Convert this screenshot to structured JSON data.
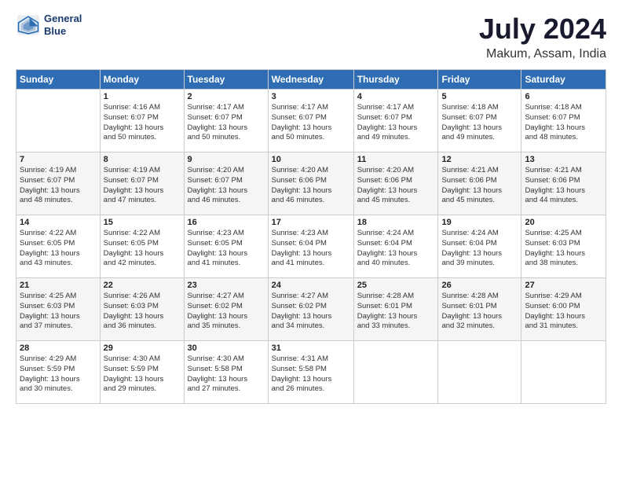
{
  "header": {
    "logo_line1": "General",
    "logo_line2": "Blue",
    "month_year": "July 2024",
    "location": "Makum, Assam, India"
  },
  "weekdays": [
    "Sunday",
    "Monday",
    "Tuesday",
    "Wednesday",
    "Thursday",
    "Friday",
    "Saturday"
  ],
  "weeks": [
    [
      {
        "day": "",
        "info": ""
      },
      {
        "day": "1",
        "info": "Sunrise: 4:16 AM\nSunset: 6:07 PM\nDaylight: 13 hours\nand 50 minutes."
      },
      {
        "day": "2",
        "info": "Sunrise: 4:17 AM\nSunset: 6:07 PM\nDaylight: 13 hours\nand 50 minutes."
      },
      {
        "day": "3",
        "info": "Sunrise: 4:17 AM\nSunset: 6:07 PM\nDaylight: 13 hours\nand 50 minutes."
      },
      {
        "day": "4",
        "info": "Sunrise: 4:17 AM\nSunset: 6:07 PM\nDaylight: 13 hours\nand 49 minutes."
      },
      {
        "day": "5",
        "info": "Sunrise: 4:18 AM\nSunset: 6:07 PM\nDaylight: 13 hours\nand 49 minutes."
      },
      {
        "day": "6",
        "info": "Sunrise: 4:18 AM\nSunset: 6:07 PM\nDaylight: 13 hours\nand 48 minutes."
      }
    ],
    [
      {
        "day": "7",
        "info": "Sunrise: 4:19 AM\nSunset: 6:07 PM\nDaylight: 13 hours\nand 48 minutes."
      },
      {
        "day": "8",
        "info": "Sunrise: 4:19 AM\nSunset: 6:07 PM\nDaylight: 13 hours\nand 47 minutes."
      },
      {
        "day": "9",
        "info": "Sunrise: 4:20 AM\nSunset: 6:07 PM\nDaylight: 13 hours\nand 46 minutes."
      },
      {
        "day": "10",
        "info": "Sunrise: 4:20 AM\nSunset: 6:06 PM\nDaylight: 13 hours\nand 46 minutes."
      },
      {
        "day": "11",
        "info": "Sunrise: 4:20 AM\nSunset: 6:06 PM\nDaylight: 13 hours\nand 45 minutes."
      },
      {
        "day": "12",
        "info": "Sunrise: 4:21 AM\nSunset: 6:06 PM\nDaylight: 13 hours\nand 45 minutes."
      },
      {
        "day": "13",
        "info": "Sunrise: 4:21 AM\nSunset: 6:06 PM\nDaylight: 13 hours\nand 44 minutes."
      }
    ],
    [
      {
        "day": "14",
        "info": "Sunrise: 4:22 AM\nSunset: 6:05 PM\nDaylight: 13 hours\nand 43 minutes."
      },
      {
        "day": "15",
        "info": "Sunrise: 4:22 AM\nSunset: 6:05 PM\nDaylight: 13 hours\nand 42 minutes."
      },
      {
        "day": "16",
        "info": "Sunrise: 4:23 AM\nSunset: 6:05 PM\nDaylight: 13 hours\nand 41 minutes."
      },
      {
        "day": "17",
        "info": "Sunrise: 4:23 AM\nSunset: 6:04 PM\nDaylight: 13 hours\nand 41 minutes."
      },
      {
        "day": "18",
        "info": "Sunrise: 4:24 AM\nSunset: 6:04 PM\nDaylight: 13 hours\nand 40 minutes."
      },
      {
        "day": "19",
        "info": "Sunrise: 4:24 AM\nSunset: 6:04 PM\nDaylight: 13 hours\nand 39 minutes."
      },
      {
        "day": "20",
        "info": "Sunrise: 4:25 AM\nSunset: 6:03 PM\nDaylight: 13 hours\nand 38 minutes."
      }
    ],
    [
      {
        "day": "21",
        "info": "Sunrise: 4:25 AM\nSunset: 6:03 PM\nDaylight: 13 hours\nand 37 minutes."
      },
      {
        "day": "22",
        "info": "Sunrise: 4:26 AM\nSunset: 6:03 PM\nDaylight: 13 hours\nand 36 minutes."
      },
      {
        "day": "23",
        "info": "Sunrise: 4:27 AM\nSunset: 6:02 PM\nDaylight: 13 hours\nand 35 minutes."
      },
      {
        "day": "24",
        "info": "Sunrise: 4:27 AM\nSunset: 6:02 PM\nDaylight: 13 hours\nand 34 minutes."
      },
      {
        "day": "25",
        "info": "Sunrise: 4:28 AM\nSunset: 6:01 PM\nDaylight: 13 hours\nand 33 minutes."
      },
      {
        "day": "26",
        "info": "Sunrise: 4:28 AM\nSunset: 6:01 PM\nDaylight: 13 hours\nand 32 minutes."
      },
      {
        "day": "27",
        "info": "Sunrise: 4:29 AM\nSunset: 6:00 PM\nDaylight: 13 hours\nand 31 minutes."
      }
    ],
    [
      {
        "day": "28",
        "info": "Sunrise: 4:29 AM\nSunset: 5:59 PM\nDaylight: 13 hours\nand 30 minutes."
      },
      {
        "day": "29",
        "info": "Sunrise: 4:30 AM\nSunset: 5:59 PM\nDaylight: 13 hours\nand 29 minutes."
      },
      {
        "day": "30",
        "info": "Sunrise: 4:30 AM\nSunset: 5:58 PM\nDaylight: 13 hours\nand 27 minutes."
      },
      {
        "day": "31",
        "info": "Sunrise: 4:31 AM\nSunset: 5:58 PM\nDaylight: 13 hours\nand 26 minutes."
      },
      {
        "day": "",
        "info": ""
      },
      {
        "day": "",
        "info": ""
      },
      {
        "day": "",
        "info": ""
      }
    ]
  ]
}
